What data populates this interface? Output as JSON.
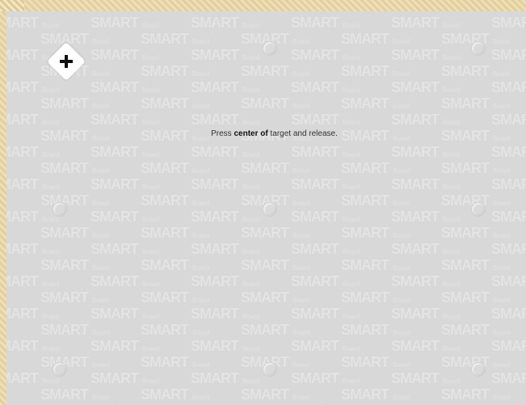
{
  "instruction": {
    "prefix": "Press ",
    "emphasis": "center of",
    "suffix": " target and release."
  },
  "watermark": {
    "brand": "SMART",
    "tagline": "Board"
  },
  "icons": {
    "active_target": "plus-icon",
    "pending_target": "circle-target-icon"
  },
  "colors": {
    "panel_background": "#d8d8d8",
    "frame_background": "#e9d9b1",
    "active_target_fill": "#ffffff",
    "text": "#111111"
  }
}
